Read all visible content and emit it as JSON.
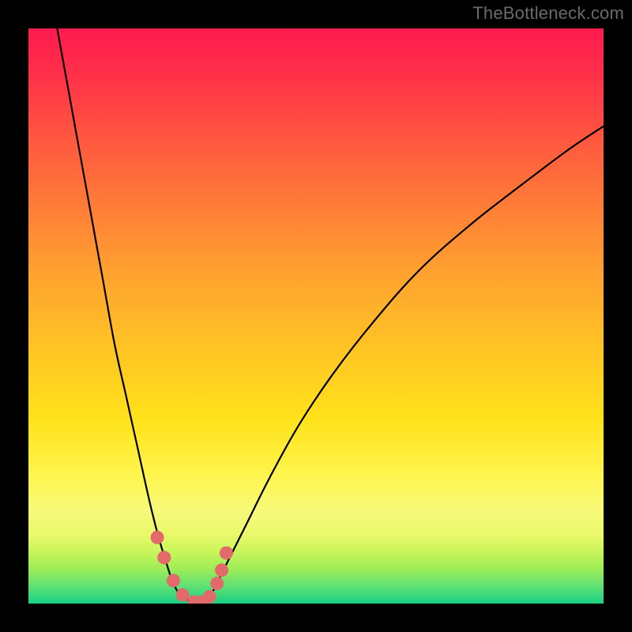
{
  "watermark": {
    "text": "TheBottleneck.com"
  },
  "chart_data": {
    "type": "line",
    "title": "",
    "xlabel": "",
    "ylabel": "",
    "xlim": [
      0,
      100
    ],
    "ylim": [
      0,
      100
    ],
    "series": [
      {
        "name": "left-curve",
        "x": [
          5,
          7,
          9,
          11,
          13,
          15,
          17,
          19,
          21,
          22.5,
          24,
          25,
          26,
          27,
          28,
          29,
          30
        ],
        "y": [
          100,
          89,
          78,
          67,
          56,
          45,
          36,
          27,
          18,
          12,
          7,
          4,
          2,
          1,
          0.5,
          0.2,
          0
        ]
      },
      {
        "name": "right-curve",
        "x": [
          30,
          31,
          32,
          33,
          35,
          38,
          42,
          47,
          53,
          60,
          68,
          77,
          86,
          94,
          100
        ],
        "y": [
          0,
          0.5,
          2,
          4,
          8,
          14,
          22,
          31,
          40,
          49,
          58,
          66,
          73,
          79,
          83
        ]
      },
      {
        "name": "pink-markers",
        "x": [
          22.4,
          23.6,
          25.2,
          26.8,
          28.8,
          30.2,
          31.5,
          32.8,
          33.6,
          34.4
        ],
        "y": [
          11.5,
          8.0,
          4.0,
          1.5,
          0.3,
          0.3,
          1.2,
          3.5,
          5.8,
          8.8
        ]
      }
    ],
    "gradient_stops": [
      {
        "pos": 0,
        "color": "#ff1a4f"
      },
      {
        "pos": 50,
        "color": "#ffc225"
      },
      {
        "pos": 100,
        "color": "#18d184"
      }
    ]
  }
}
